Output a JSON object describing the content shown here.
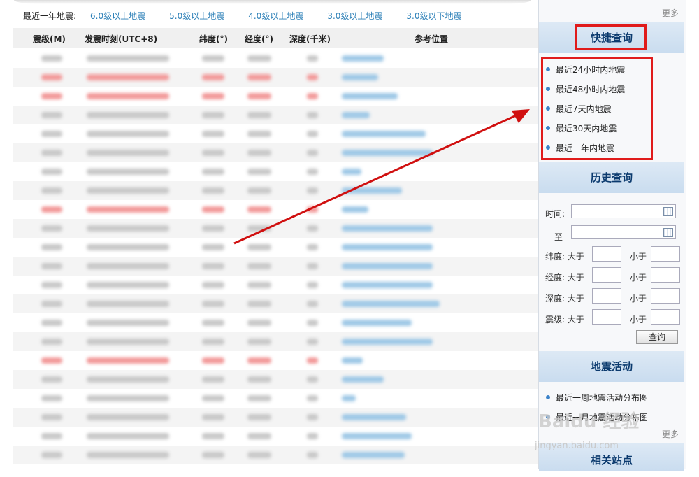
{
  "filter": {
    "label": "最近一年地震:",
    "links": [
      "6.0级以上地震",
      "5.0级以上地震",
      "4.0级以上地震",
      "3.0级以上地震",
      "3.0级以下地震"
    ]
  },
  "table": {
    "headers": {
      "mag": "震级(M)",
      "time": "发震时刻(UTC+8)",
      "lat": "纬度(°)",
      "lon": "经度(°)",
      "depth": "深度(千米)",
      "loc": "参考位置"
    }
  },
  "sidebar": {
    "more_label": "更多",
    "quick": {
      "title": "快捷查询",
      "items": [
        "最近24小时内地震",
        "最近48小时内地震",
        "最近7天内地震",
        "最近30天内地震",
        "最近一年内地震"
      ]
    },
    "history": {
      "title": "历史查询",
      "time_label": "时间:",
      "to_label": "至",
      "lat_label": "纬度: 大于",
      "lon_label": "经度: 大于",
      "depth_label": "深度: 大于",
      "mag_label": "震级: 大于",
      "less_label": "小于",
      "query_button": "查询"
    },
    "activity": {
      "title": "地震活动",
      "items": [
        "最近一周地震活动分布图",
        "最近一月地震活动分布图"
      ]
    },
    "related_title": "相关站点"
  },
  "watermark": {
    "text": "Baidu 经验",
    "sub": "jingyan.baidu.com"
  },
  "colors": {
    "link": "#2b7fb7",
    "highlight": "#e01b1b",
    "section_bg": "#c9dcef"
  }
}
